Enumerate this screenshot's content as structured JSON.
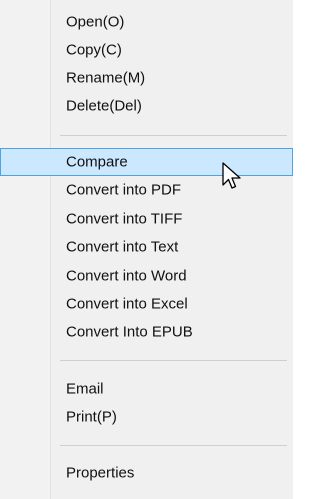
{
  "context_menu": {
    "items": [
      {
        "label": "Open(O)"
      },
      {
        "label": "Copy(C)"
      },
      {
        "label": "Rename(M)"
      },
      {
        "label": "Delete(Del)"
      },
      {
        "label": "Compare"
      },
      {
        "label": "Convert into PDF"
      },
      {
        "label": "Convert into TIFF"
      },
      {
        "label": "Convert into Text"
      },
      {
        "label": "Convert into Word"
      },
      {
        "label": "Convert into Excel"
      },
      {
        "label": "Convert Into EPUB"
      },
      {
        "label": "Email"
      },
      {
        "label": "Print(P)"
      },
      {
        "label": "Properties"
      }
    ],
    "highlighted_item": "Compare",
    "colors": {
      "highlight_fill": "#cce8ff",
      "highlight_border": "#4ea3e4",
      "menu_background": "#f0f0f0"
    }
  },
  "cursor": {
    "icon": "arrow-pointer-icon"
  }
}
